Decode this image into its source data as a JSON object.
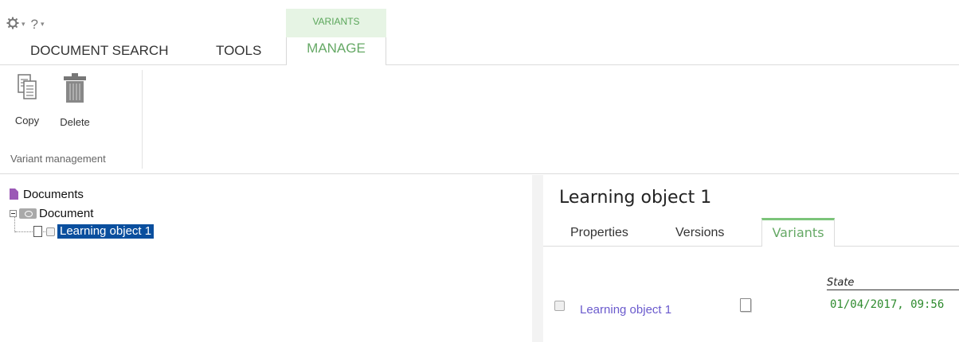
{
  "quick_access": {
    "settings_icon": "gear-icon",
    "help_label": "?"
  },
  "ribbon": {
    "contextual_group": "VARIANTS",
    "tabs": [
      {
        "label": "DOCUMENT SEARCH"
      },
      {
        "label": "TOOLS"
      },
      {
        "label": "MANAGE",
        "active": true
      }
    ],
    "buttons": [
      {
        "label": "Copy",
        "icon": "copy-icon"
      },
      {
        "label": "Delete",
        "icon": "trash-icon"
      }
    ],
    "group_label": "Variant management"
  },
  "tree": {
    "root": "Documents",
    "folder": "Document",
    "item": "Learning object 1"
  },
  "details": {
    "title": "Learning object 1",
    "tabs": [
      {
        "label": "Properties"
      },
      {
        "label": "Versions"
      },
      {
        "label": "Variants",
        "active": true
      }
    ],
    "table": {
      "state_header": "State",
      "rows": [
        {
          "name": "Learning object 1",
          "state": "01/04/2017, 09:56"
        }
      ]
    }
  },
  "colors": {
    "accent_green": "#66a966",
    "selection_blue": "#0a4f9e",
    "link_purple": "#6a5acd",
    "date_green": "#2e8b2e"
  }
}
